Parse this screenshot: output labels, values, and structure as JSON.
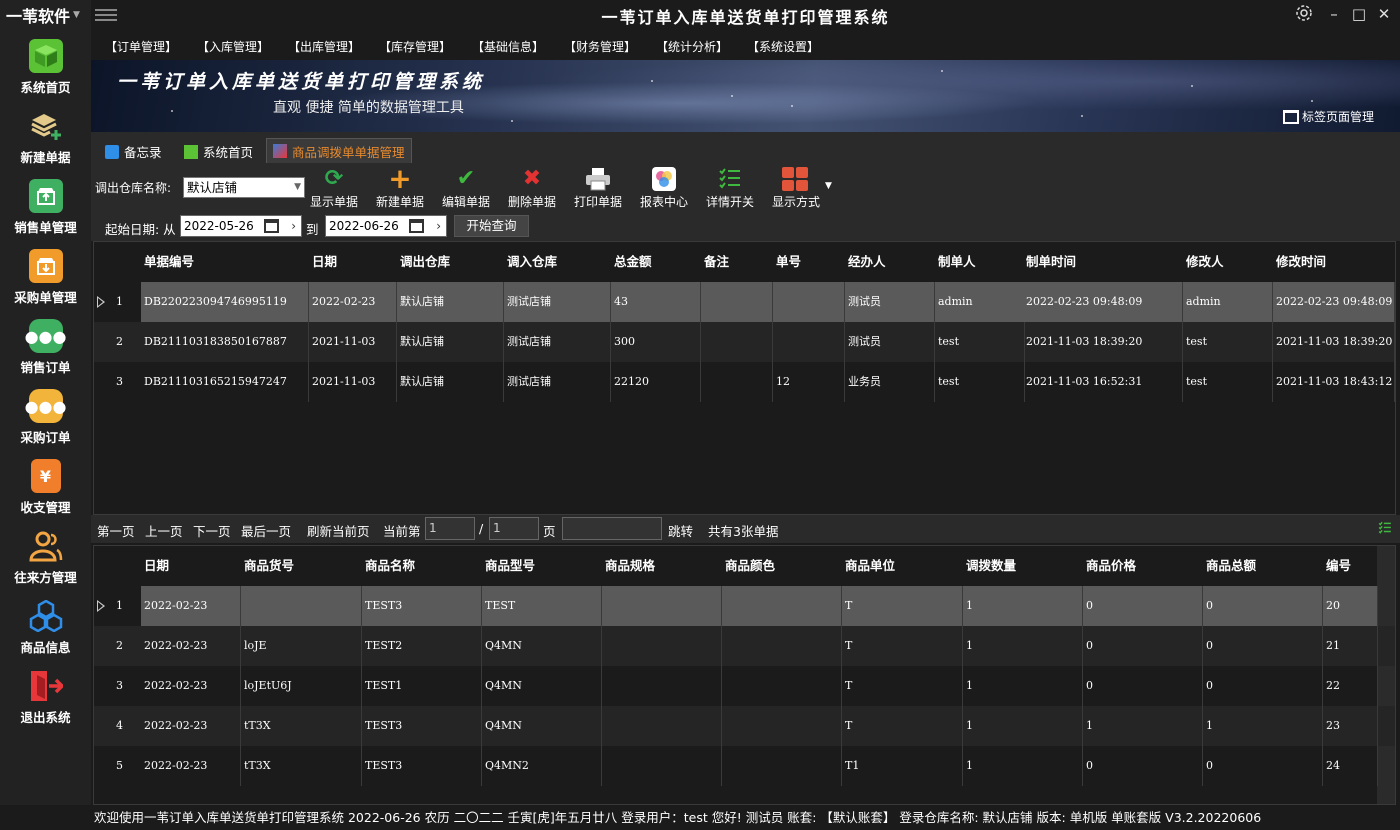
{
  "brand": {
    "name": "一苇软件"
  },
  "sidebar": {
    "items": [
      {
        "label": "系统首页",
        "icon": "cube-icon",
        "color": "#5bc236"
      },
      {
        "label": "新建单据",
        "icon": "layers-add-icon",
        "color": "#d9b877"
      },
      {
        "label": "销售单管理",
        "icon": "box-out-icon",
        "color": "#3fb061"
      },
      {
        "label": "采购单管理",
        "icon": "box-in-icon",
        "color": "#f09b2a"
      },
      {
        "label": "销售订单",
        "icon": "dots-bubble-icon",
        "color": "#3fb061"
      },
      {
        "label": "采购订单",
        "icon": "dots-bubble-icon",
        "color": "#f2b43a"
      },
      {
        "label": "收支管理",
        "icon": "yen-icon",
        "color": "#f07e2a"
      },
      {
        "label": "往来方管理",
        "icon": "contacts-icon",
        "color": "#f2a542"
      },
      {
        "label": "商品信息",
        "icon": "cubes-icon",
        "color": "#2f8ee8"
      },
      {
        "label": "退出系统",
        "icon": "exit-icon",
        "color": "#e8373a"
      }
    ]
  },
  "app": {
    "title": "一苇订单入库单送货单打印管理系统"
  },
  "menu": [
    "【订单管理】",
    "【入库管理】",
    "【出库管理】",
    "【库存管理】",
    "【基础信息】",
    "【财务管理】",
    "【统计分析】",
    "【系统设置】"
  ],
  "banner": {
    "title": "一苇订单入库单送货单打印管理系统",
    "subtitle": "直观 便捷 简单的数据管理工具",
    "tab_manager": "标签页面管理"
  },
  "tabs": [
    {
      "label": "备忘录",
      "icon": "memo-icon"
    },
    {
      "label": "系统首页",
      "icon": "cube-icon"
    },
    {
      "label": "商品调拨单单据管理",
      "icon": "transfer-icon"
    }
  ],
  "toolbar": {
    "warehouse_label": "调出仓库名称:",
    "warehouse_value": "默认店铺",
    "buttons": [
      {
        "label": "显示单据",
        "icon": "refresh-icon",
        "color": "#2fa84f"
      },
      {
        "label": "新建单据",
        "icon": "plus-icon",
        "color": "#f09b2a"
      },
      {
        "label": "编辑单据",
        "icon": "check-icon",
        "color": "#3fb83f"
      },
      {
        "label": "删除单据",
        "icon": "x-icon",
        "color": "#e23232"
      },
      {
        "label": "打印单据",
        "icon": "printer-icon",
        "color": "#dddddd"
      },
      {
        "label": "报表中心",
        "icon": "report-icon",
        "color": "#e86aa0"
      },
      {
        "label": "详情开关",
        "icon": "list-check-icon",
        "color": "#3fb83f"
      },
      {
        "label": "显示方式",
        "icon": "grid-icon",
        "color": "#e2553a"
      }
    ]
  },
  "filter": {
    "label": "起始日期: 从",
    "from": "2022-05-26",
    "to_label": "到",
    "to": "2022-06-26",
    "query_label": "开始查询"
  },
  "master": {
    "headers": [
      "单据编号",
      "日期",
      "调出仓库",
      "调入仓库",
      "总金额",
      "备注",
      "单号",
      "经办人",
      "制单人",
      "制单时间",
      "修改人",
      "修改时间"
    ],
    "rows": [
      {
        "n": "1",
        "cells": [
          "DB220223094746995119",
          "2022-02-23",
          "默认店铺",
          "测试店铺",
          "43",
          "",
          "",
          "测试员",
          "admin",
          "2022-02-23 09:48:09",
          "admin",
          "2022-02-23 09:48:09"
        ]
      },
      {
        "n": "2",
        "cells": [
          "DB211103183850167887",
          "2021-11-03",
          "默认店铺",
          "测试店铺",
          "300",
          "",
          "",
          "测试员",
          "test",
          "2021-11-03 18:39:20",
          "test",
          "2021-11-03 18:39:20"
        ]
      },
      {
        "n": "3",
        "cells": [
          "DB211103165215947247",
          "2021-11-03",
          "默认店铺",
          "测试店铺",
          "22120",
          "",
          "12",
          "业务员",
          "test",
          "2021-11-03 16:52:31",
          "test",
          "2021-11-03 18:43:12"
        ]
      }
    ]
  },
  "pager": {
    "first": "第一页",
    "prev": "上一页",
    "next": "下一页",
    "last": "最后一页",
    "refresh": "刷新当前页",
    "current_label": "当前第",
    "current": "1",
    "sep": "/",
    "total_pages": "1",
    "page_unit": "页",
    "jump": "跳转",
    "summary": "共有3张单据"
  },
  "detail": {
    "headers": [
      "日期",
      "商品货号",
      "商品名称",
      "商品型号",
      "商品规格",
      "商品颜色",
      "商品单位",
      "调拨数量",
      "商品价格",
      "商品总额",
      "编号"
    ],
    "rows": [
      {
        "n": "1",
        "cells": [
          "2022-02-23",
          "",
          "TEST3",
          "TEST",
          "",
          "",
          "T",
          "1",
          "0",
          "0",
          "20"
        ]
      },
      {
        "n": "2",
        "cells": [
          "2022-02-23",
          "loJE",
          "TEST2",
          "Q4MN",
          "",
          "",
          "T",
          "1",
          "0",
          "0",
          "21"
        ]
      },
      {
        "n": "3",
        "cells": [
          "2022-02-23",
          "loJEtU6J",
          "TEST1",
          "Q4MN",
          "",
          "",
          "T",
          "1",
          "0",
          "0",
          "22"
        ]
      },
      {
        "n": "4",
        "cells": [
          "2022-02-23",
          "tT3X",
          "TEST3",
          "Q4MN",
          "",
          "",
          "T",
          "1",
          "1",
          "1",
          "23"
        ]
      },
      {
        "n": "5",
        "cells": [
          "2022-02-23",
          "tT3X",
          "TEST3",
          "Q4MN2",
          "",
          "",
          "T1",
          "1",
          "0",
          "0",
          "24"
        ]
      }
    ]
  },
  "status": {
    "text": "欢迎使用一苇订单入库单送货单打印管理系统 2022-06-26 农历 二〇二二 壬寅[虎]年五月廿八 登录用户：test 您好! 测试员 账套: 【默认账套】 登录仓库名称: 默认店铺 版本: 单机版 单账套版 V3.2.20220606"
  }
}
